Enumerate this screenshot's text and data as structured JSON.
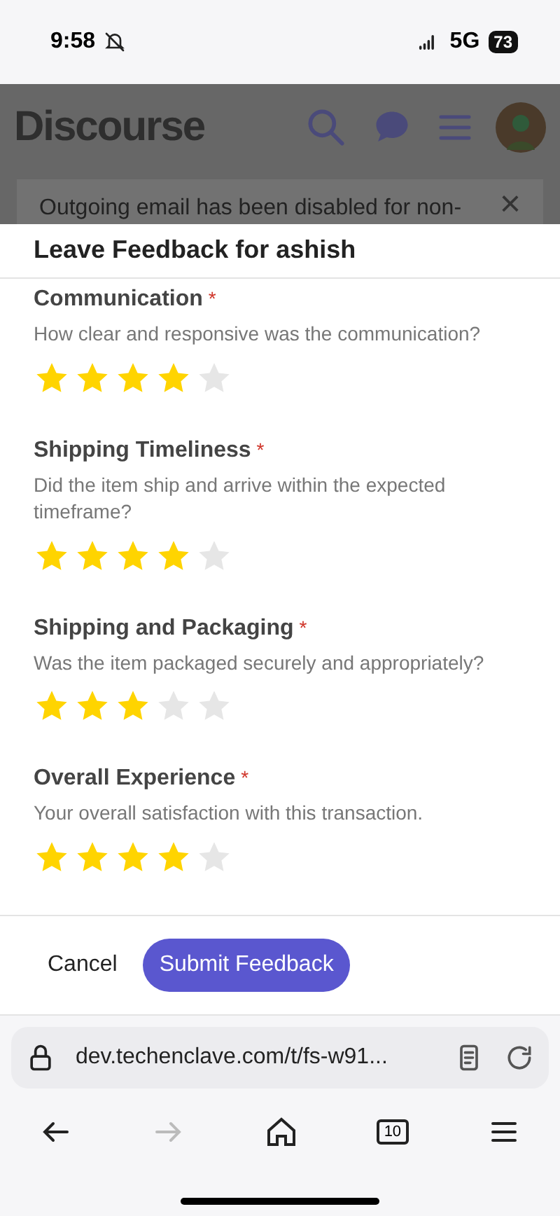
{
  "status_bar": {
    "time": "9:58",
    "network": "5G",
    "battery": "73"
  },
  "site_header": {
    "logo": "Discourse"
  },
  "banner": {
    "text": "Outgoing email has been disabled for non-",
    "close": "×"
  },
  "modal": {
    "title": "Leave Feedback for ashish",
    "questions": [
      {
        "label": "Communication",
        "required_mark": "*",
        "hint": "How clear and responsive was the communication?",
        "stars": 4
      },
      {
        "label": "Shipping Timeliness",
        "required_mark": "*",
        "hint": "Did the item ship and arrive within the expected timeframe?",
        "stars": 4
      },
      {
        "label": "Shipping and Packaging",
        "required_mark": "*",
        "hint": "Was the item packaged securely and appropriately?",
        "stars": 3
      },
      {
        "label": "Overall Experience",
        "required_mark": "*",
        "hint": "Your overall satisfaction with this transaction.",
        "stars": 4
      }
    ],
    "buttons": [
      {
        "label": "Cancel",
        "kind": "link"
      },
      {
        "label": "Submit Feedback",
        "kind": "primary"
      }
    ]
  },
  "browser": {
    "url": "dev.techenclave.com/t/fs-w91...",
    "tabs_count": "10"
  }
}
